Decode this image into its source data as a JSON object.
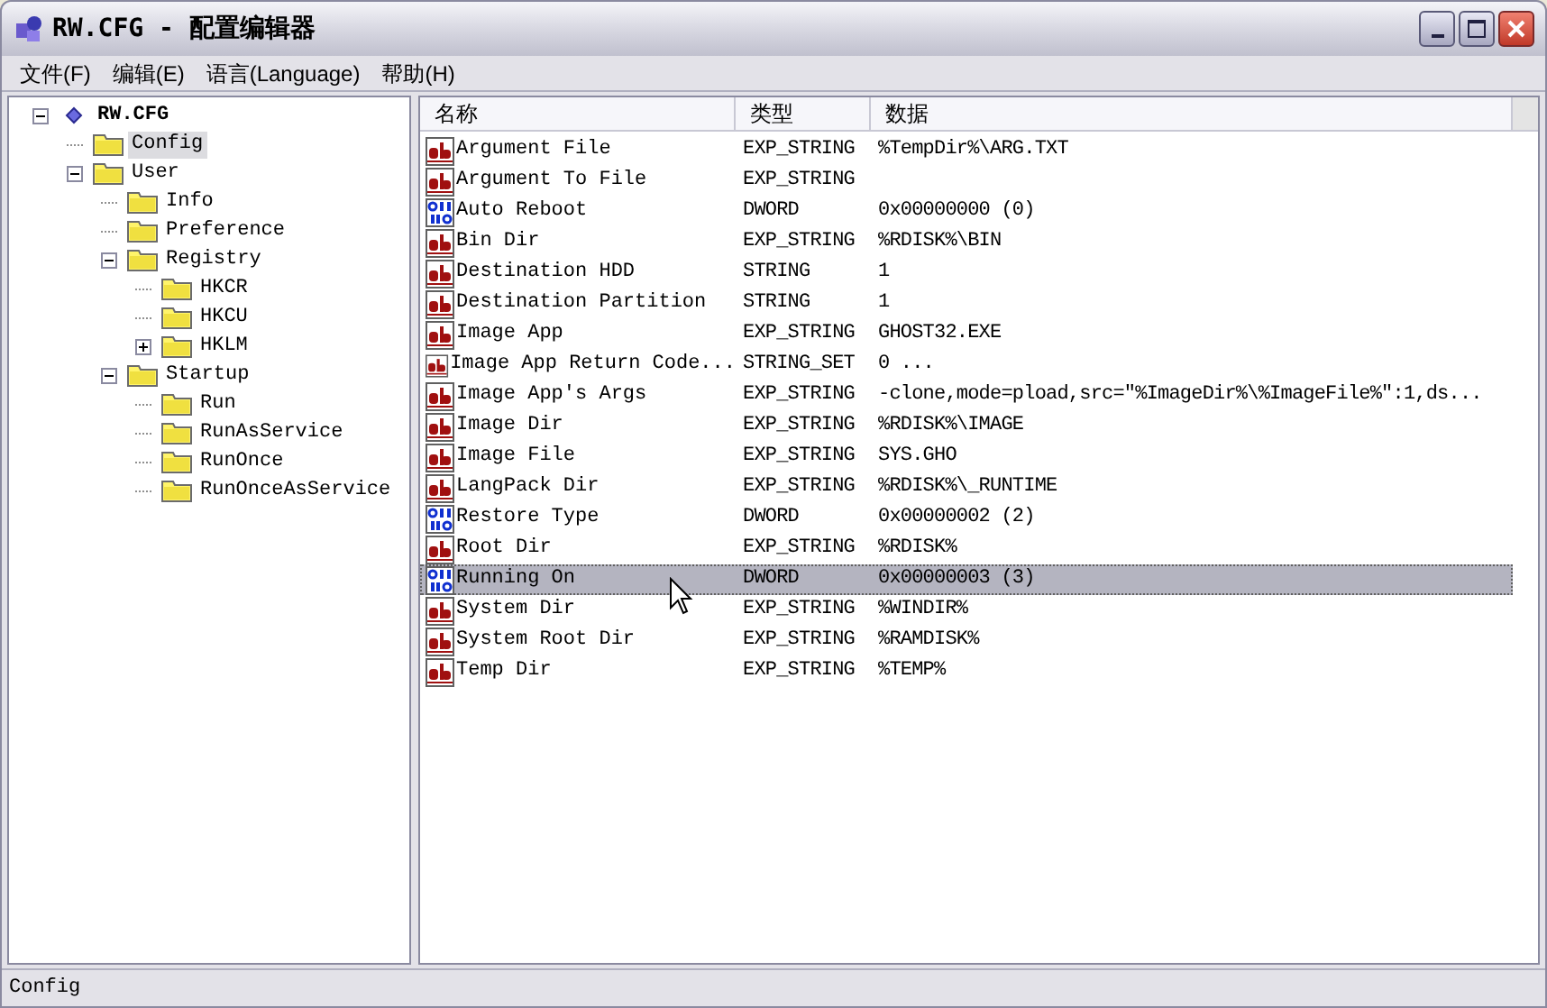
{
  "window": {
    "title": "RW.CFG - 配置编辑器"
  },
  "menu": [
    "文件(F)",
    "编辑(E)",
    "语言(Language)",
    "帮助(H)"
  ],
  "tree": [
    {
      "label": "RW.CFG",
      "kind": "root",
      "expanded": true,
      "selected": false,
      "children": [
        {
          "label": "Config",
          "kind": "folder",
          "selected": true
        },
        {
          "label": "User",
          "kind": "folder",
          "expanded": true,
          "selected": false,
          "children": [
            {
              "label": "Info",
              "kind": "folder",
              "selected": false
            },
            {
              "label": "Preference",
              "kind": "folder",
              "selected": false
            },
            {
              "label": "Registry",
              "kind": "folder",
              "expanded": true,
              "selected": false,
              "children": [
                {
                  "label": "HKCR",
                  "kind": "folder",
                  "selected": false
                },
                {
                  "label": "HKCU",
                  "kind": "folder",
                  "selected": false
                },
                {
                  "label": "HKLM",
                  "kind": "folder",
                  "expanded": false,
                  "selected": false
                }
              ]
            },
            {
              "label": "Startup",
              "kind": "folder",
              "expanded": true,
              "selected": false,
              "children": [
                {
                  "label": "Run",
                  "kind": "folder",
                  "selected": false
                },
                {
                  "label": "RunAsService",
                  "kind": "folder",
                  "selected": false
                },
                {
                  "label": "RunOnce",
                  "kind": "folder",
                  "selected": false
                },
                {
                  "label": "RunOnceAsService",
                  "kind": "folder",
                  "selected": false
                }
              ]
            }
          ]
        }
      ]
    }
  ],
  "table": {
    "columns": [
      "名称",
      "类型",
      "数据"
    ],
    "rows": [
      {
        "name": "Argument File",
        "type": "EXP_STRING",
        "data": "%TempDir%\\ARG.TXT",
        "kind": "string",
        "selected": false
      },
      {
        "name": "Argument To File",
        "type": "EXP_STRING",
        "data": "",
        "kind": "string",
        "selected": false
      },
      {
        "name": "Auto Reboot",
        "type": "DWORD",
        "data": "0x00000000 (0)",
        "kind": "dword",
        "selected": false
      },
      {
        "name": "Bin Dir",
        "type": "EXP_STRING",
        "data": "%RDISK%\\BIN",
        "kind": "string",
        "selected": false
      },
      {
        "name": "Destination HDD",
        "type": "STRING",
        "data": "1",
        "kind": "string",
        "selected": false
      },
      {
        "name": "Destination Partition",
        "type": "STRING",
        "data": "1",
        "kind": "string",
        "selected": false
      },
      {
        "name": "Image App",
        "type": "EXP_STRING",
        "data": "GHOST32.EXE",
        "kind": "string",
        "selected": false
      },
      {
        "name": "Image App Return Code...",
        "type": "STRING_SET",
        "data": "0 ...",
        "kind": "string",
        "selected": false
      },
      {
        "name": "Image App's Args",
        "type": "EXP_STRING",
        "data": "-clone,mode=pload,src=\"%ImageDir%\\%ImageFile%\":1,ds...",
        "kind": "string",
        "selected": false
      },
      {
        "name": "Image Dir",
        "type": "EXP_STRING",
        "data": "%RDISK%\\IMAGE",
        "kind": "string",
        "selected": false
      },
      {
        "name": "Image File",
        "type": "EXP_STRING",
        "data": "SYS.GHO",
        "kind": "string",
        "selected": false
      },
      {
        "name": "LangPack Dir",
        "type": "EXP_STRING",
        "data": "%RDISK%\\_RUNTIME",
        "kind": "string",
        "selected": false
      },
      {
        "name": "Restore Type",
        "type": "DWORD",
        "data": "0x00000002 (2)",
        "kind": "dword",
        "selected": false
      },
      {
        "name": "Root Dir",
        "type": "EXP_STRING",
        "data": "%RDISK%",
        "kind": "string",
        "selected": false
      },
      {
        "name": "Running On",
        "type": "DWORD",
        "data": "0x00000003 (3)",
        "kind": "dword",
        "selected": true
      },
      {
        "name": "System Dir",
        "type": "EXP_STRING",
        "data": "%WINDIR%",
        "kind": "string",
        "selected": false
      },
      {
        "name": "System Root Dir",
        "type": "EXP_STRING",
        "data": "%RAMDISK%",
        "kind": "string",
        "selected": false
      },
      {
        "name": "Temp Dir",
        "type": "EXP_STRING",
        "data": "%TEMP%",
        "kind": "string",
        "selected": false
      }
    ]
  },
  "status_bar": "Config"
}
